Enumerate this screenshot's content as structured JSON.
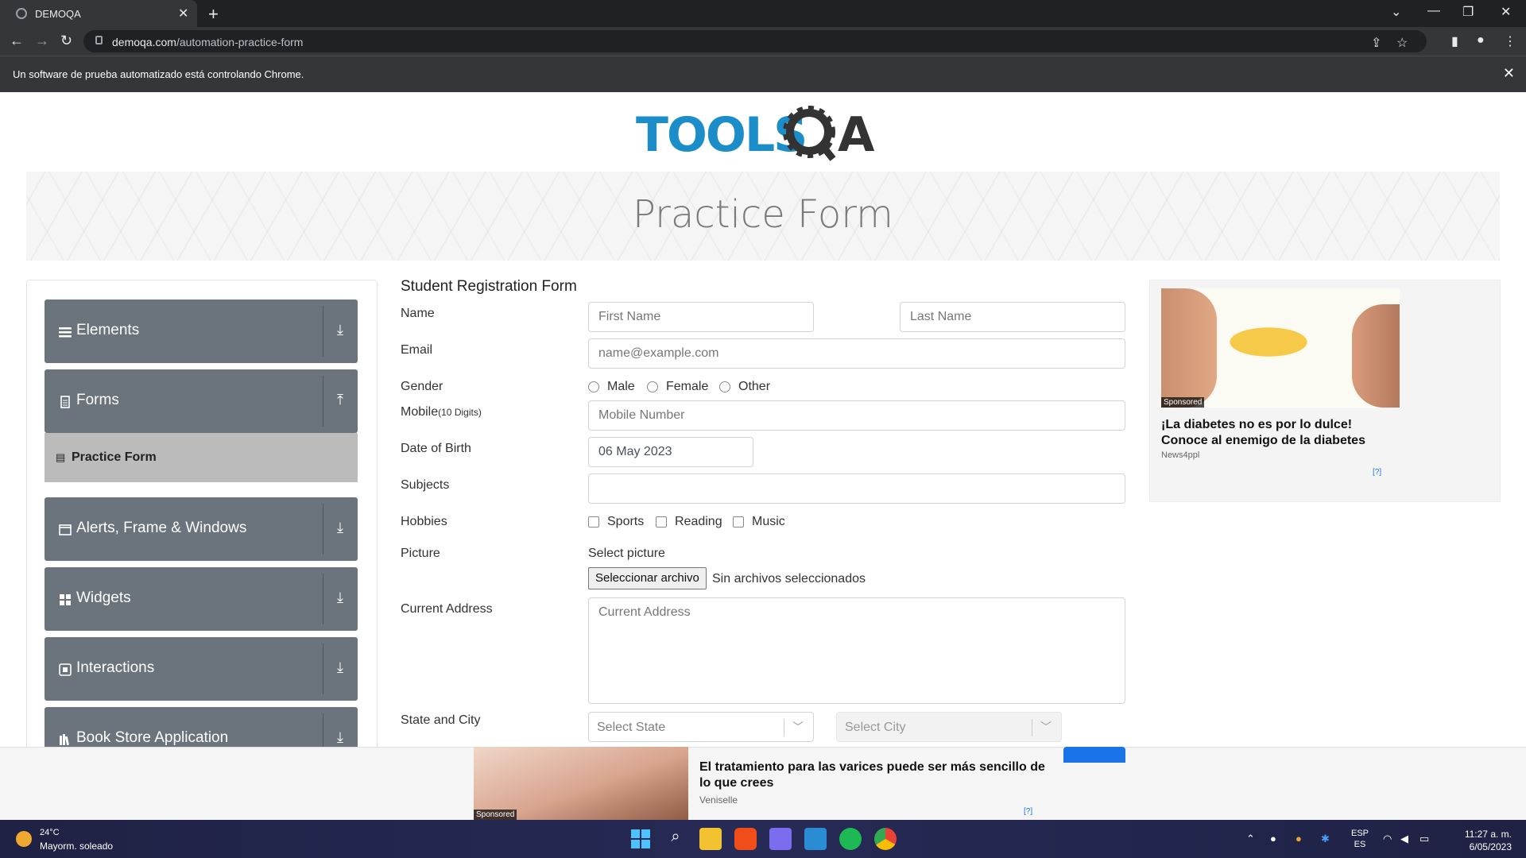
{
  "browser": {
    "tab_title": "DEMOQA",
    "url_host": "demoqa.com",
    "url_path": "/automation-practice-form",
    "infobar_message": "Un software de prueba automatizado está controlando Chrome."
  },
  "header": {
    "logo_text": "TOOLSQA",
    "page_title": "Practice Form"
  },
  "sidebar": {
    "groups": [
      {
        "label": "Elements",
        "icon": "menu-icon",
        "arrow": "download-icon"
      },
      {
        "label": "Forms",
        "icon": "document-icon",
        "arrow": "upload-icon"
      },
      {
        "label": "Alerts, Frame & Windows",
        "icon": "window-icon",
        "arrow": "download-icon"
      },
      {
        "label": "Widgets",
        "icon": "grid-icon",
        "arrow": "download-icon"
      },
      {
        "label": "Interactions",
        "icon": "interaction-icon",
        "arrow": "download-icon"
      },
      {
        "label": "Book Store Application",
        "icon": "books-icon",
        "arrow": "download-icon"
      }
    ],
    "subitem": {
      "label": "Practice Form",
      "icon": "document-icon"
    }
  },
  "form": {
    "heading": "Student Registration Form",
    "name_label": "Name",
    "first_name_placeholder": "First Name",
    "last_name_placeholder": "Last Name",
    "email_label": "Email",
    "email_placeholder": "name@example.com",
    "gender_label": "Gender",
    "gender_options": [
      "Male",
      "Female",
      "Other"
    ],
    "mobile_label": "Mobile",
    "mobile_hint": "(10 Digits)",
    "mobile_placeholder": "Mobile Number",
    "dob_label": "Date of Birth",
    "dob_value": "06 May 2023",
    "subjects_label": "Subjects",
    "hobbies_label": "Hobbies",
    "hobbies_options": [
      "Sports",
      "Reading",
      "Music"
    ],
    "picture_label": "Picture",
    "select_picture_text": "Select picture",
    "file_button": "Seleccionar archivo",
    "file_status": "Sin archivos seleccionados",
    "address_label": "Current Address",
    "address_placeholder": "Current Address",
    "state_city_label": "State and City",
    "state_placeholder": "Select State",
    "city_placeholder": "Select City"
  },
  "ads": {
    "side": {
      "sponsored": "Sponsored",
      "headline": "¡La diabetes no es por lo dulce! Conoce al enemigo de la diabetes",
      "source": "News4ppl",
      "choices": "[?]"
    },
    "bottom": {
      "sponsored": "Sponsored",
      "headline": "El tratamiento para las varices puede ser más sencillo de lo que crees",
      "source": "Veniselle",
      "choices": "[?]"
    }
  },
  "taskbar": {
    "temperature": "24°C",
    "weather": "Mayorm. soleado",
    "lang_line1": "ESP",
    "lang_line2": "ES",
    "time": "11:27 a. m.",
    "date": "6/05/2023"
  },
  "colors": {
    "sidebar_group": "#6b737c",
    "sidebar_selected": "#bbbbbb",
    "logo_blue": "#1b8ec9",
    "logo_dark": "#333333"
  }
}
